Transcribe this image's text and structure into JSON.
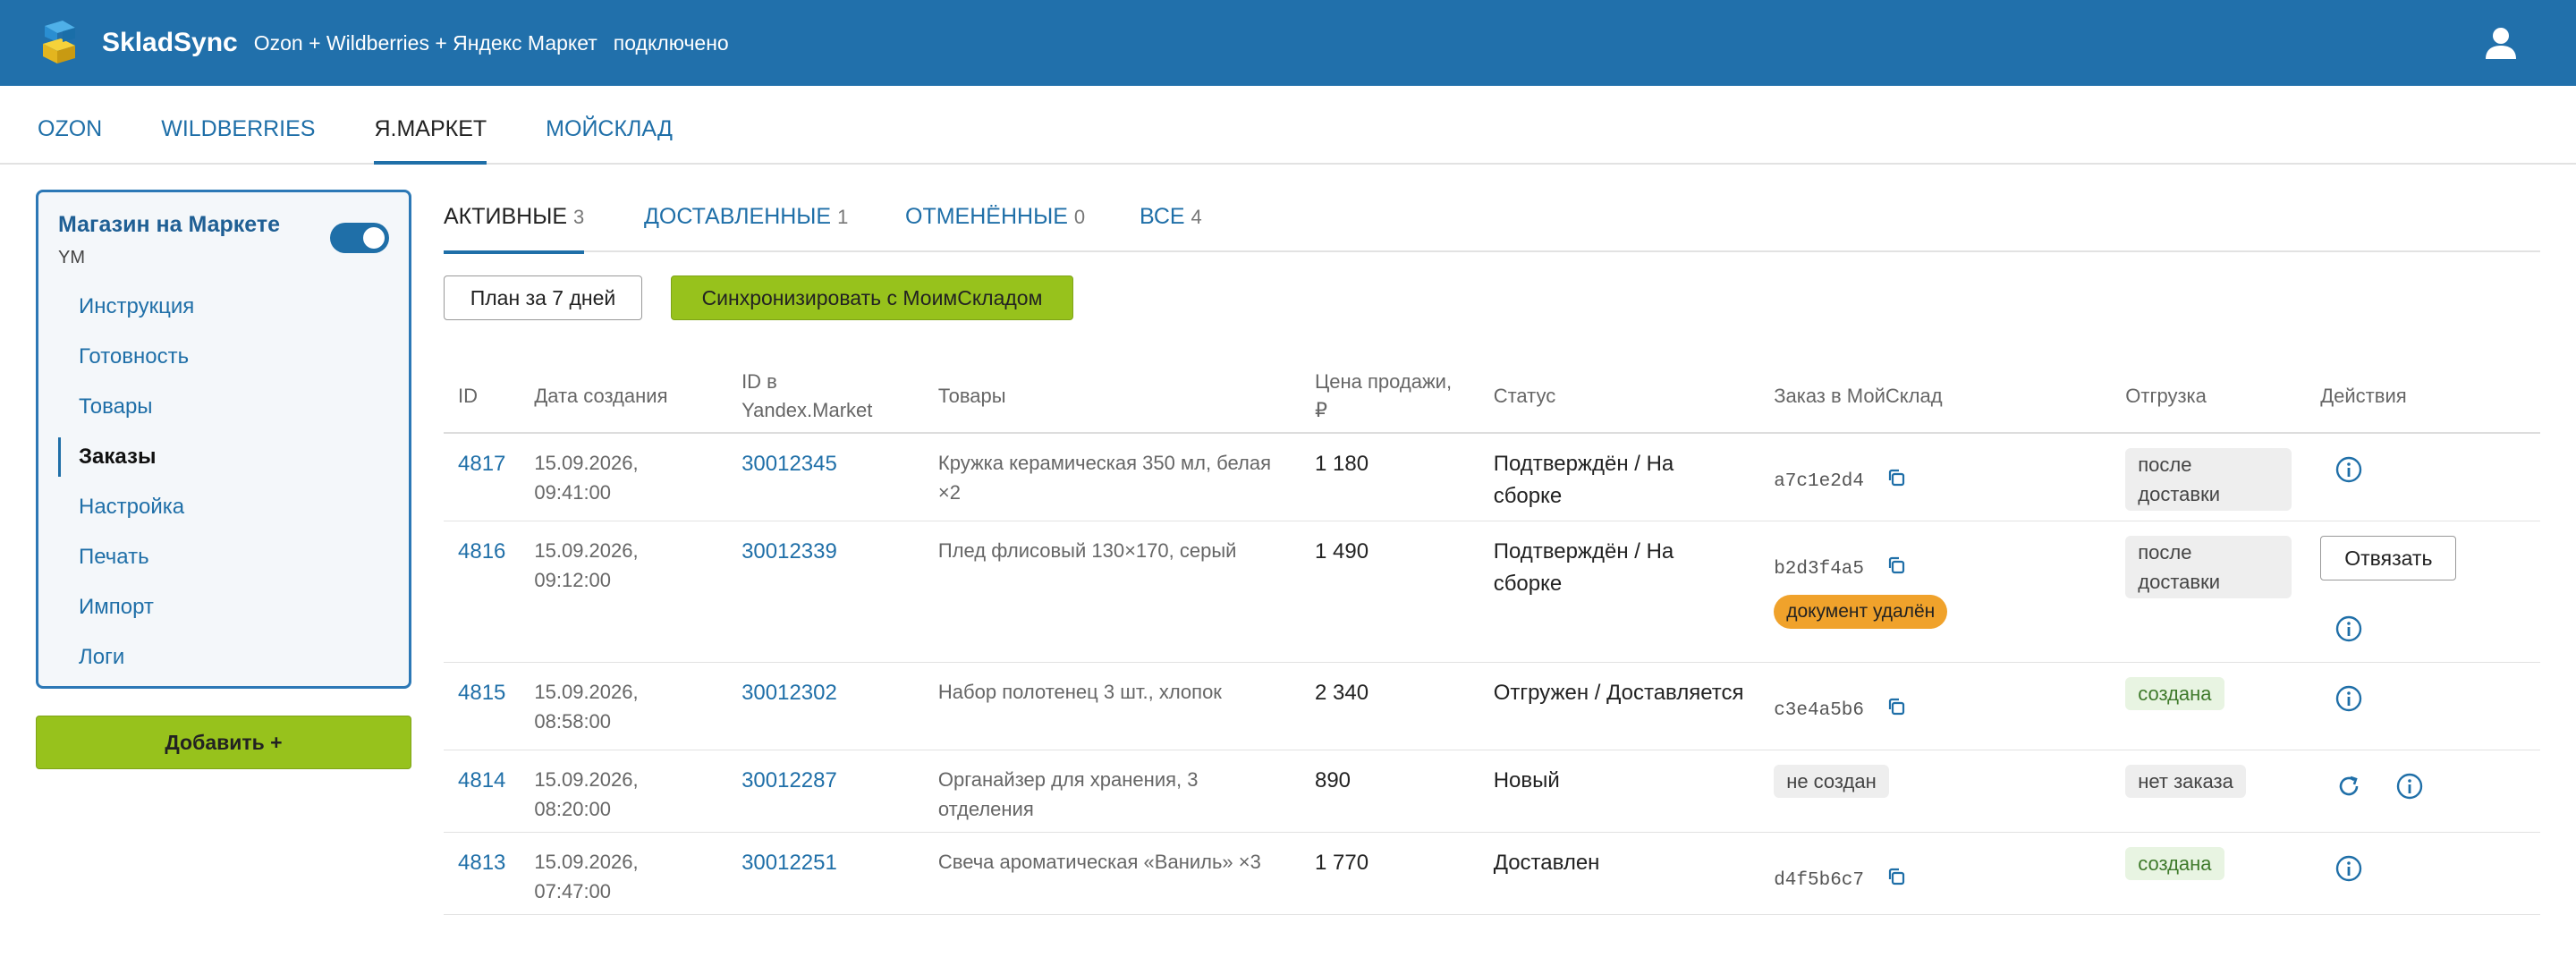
{
  "header": {
    "brand": "SkladSync",
    "connection": "Ozon + Wildberries + Яндекс Маркет",
    "status": "подключено"
  },
  "marketplace_tabs": [
    {
      "label": "OZON",
      "active": false
    },
    {
      "label": "WILDBERRIES",
      "active": false
    },
    {
      "label": "Я.МАРКЕТ",
      "active": true
    },
    {
      "label": "МОЙСКЛАД",
      "active": false
    }
  ],
  "sidebar": {
    "store_title": "Магазин на Маркете",
    "store_code": "YM",
    "toggle_on": true,
    "items": [
      {
        "label": "Инструкция",
        "active": false
      },
      {
        "label": "Готовность",
        "active": false
      },
      {
        "label": "Товары",
        "active": false
      },
      {
        "label": "Заказы",
        "active": true
      },
      {
        "label": "Настройка",
        "active": false
      },
      {
        "label": "Печать",
        "active": false
      },
      {
        "label": "Импорт",
        "active": false
      },
      {
        "label": "Логи",
        "active": false
      }
    ],
    "add_button": "Добавить +"
  },
  "status_tabs": [
    {
      "label": "АКТИВНЫЕ",
      "count": "3",
      "active": true
    },
    {
      "label": "ДОСТАВЛЕННЫЕ",
      "count": "1",
      "active": false
    },
    {
      "label": "ОТМЕНЁННЫЕ",
      "count": "0",
      "active": false
    },
    {
      "label": "ВСЕ",
      "count": "4",
      "active": false
    }
  ],
  "buttons": {
    "plan": "План за 7 дней",
    "sync": "Синхронизировать с МоимСкладом"
  },
  "table": {
    "headers": {
      "id": "ID",
      "created": "Дата создания",
      "ym_id_1": "ID в",
      "ym_id_2": "Yandex.Market",
      "goods": "Товары",
      "price_1": "Цена продажи,",
      "price_2": "₽",
      "status": "Статус",
      "ms_order": "Заказ в МойСклад",
      "shipment": "Отгрузка",
      "actions": "Действия"
    },
    "rows": [
      {
        "id": "4817",
        "date": "15.09.2026,",
        "time": "09:41:00",
        "ym_id": "30012345",
        "goods": "Кружка керамическая 350 мл, белая ×2",
        "price": "1 180",
        "status": "Подтверждён / На сборке",
        "ms": "a7c1e2d4",
        "ms_badge": "",
        "ship": "после доставки",
        "unlink": ""
      },
      {
        "id": "4816",
        "date": "15.09.2026,",
        "time": "09:12:00",
        "ym_id": "30012339",
        "goods": "Плед флисовый 130×170, серый",
        "price": "1 490",
        "status": "Подтверждён / На сборке",
        "ms": "b2d3f4a5",
        "ms_badge": "документ удалён",
        "ship": "после доставки",
        "unlink": "Отвязать"
      },
      {
        "id": "4815",
        "date": "15.09.2026,",
        "time": "08:58:00",
        "ym_id": "30012302",
        "goods": "Набор полотенец 3 шт., хлопок",
        "price": "2 340",
        "status": "Отгружен / Доставляется",
        "ms": "c3e4a5b6",
        "ms_badge": "",
        "ship": "создана",
        "unlink": ""
      },
      {
        "id": "4814",
        "date": "15.09.2026,",
        "time": "08:20:00",
        "ym_id": "30012287",
        "goods": "Органайзер для хранения, 3 отделения",
        "price": "890",
        "status": "Новый",
        "ms": "",
        "ms_badge": "не создан",
        "ship": "нет заказа",
        "unlink": ""
      },
      {
        "id": "4813",
        "date": "15.09.2026,",
        "time": "07:47:00",
        "ym_id": "30012251",
        "goods": "Свеча ароматическая «Ваниль» ×3",
        "price": "1 770",
        "status": "Доставлен",
        "ms": "d4f5b6c7",
        "ms_badge": "",
        "ship": "создана",
        "unlink": ""
      }
    ]
  },
  "colors": {
    "header_bg": "#2170ab",
    "accent": "#1f6fa8",
    "primary_button": "#97c21c",
    "warning_badge": "#f0a22b",
    "success_badge": "#e8f4e2"
  }
}
